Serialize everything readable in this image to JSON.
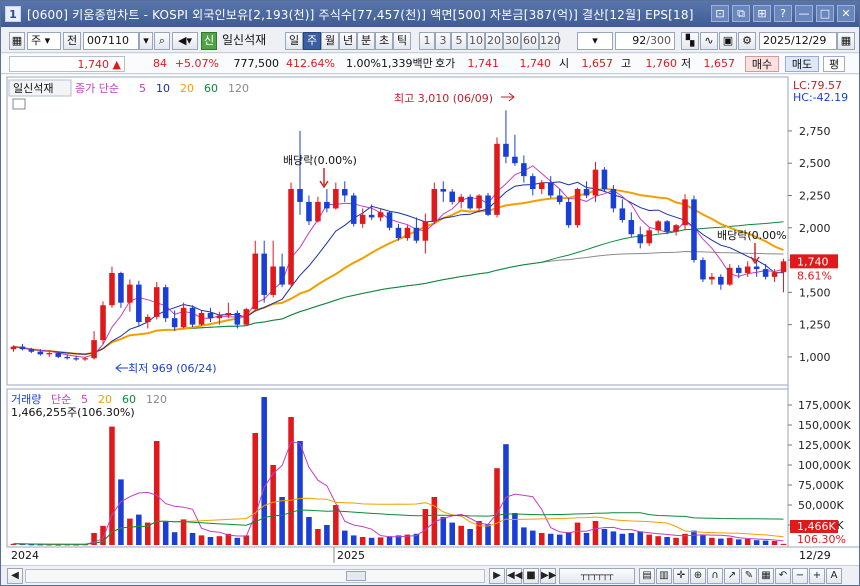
{
  "window": {
    "title": "[0600] 키움종합차트 - KOSPI 외국인보유[2,193(천)] 주식수[77,457(천)] 액면[500] 자본금[387(억)] 결산[12월] EPS[18]",
    "icon_label": "1",
    "controls": [
      "?",
      "_",
      "□",
      "?",
      "—",
      "✕"
    ]
  },
  "toolbar": {
    "market_select": "주",
    "market_icon": "전",
    "stock_code": "007110",
    "stock_name": "일신석재",
    "periods": [
      "일",
      "주",
      "월",
      "년",
      "분",
      "초",
      "틱"
    ],
    "active_period": "주",
    "intervals": [
      "1",
      "3",
      "5",
      "10",
      "20",
      "30",
      "60",
      "120"
    ],
    "count": "92",
    "count_total": "/300",
    "date": "2025/12/29",
    "badge": "신"
  },
  "quote": {
    "price": "1,740",
    "arrow": "▲",
    "change": "84",
    "change_pct": "+5.07%",
    "volume": "777,500",
    "volume_ratio": "412.64%",
    "turnover": "1.00%",
    "amount": "1,339백만",
    "hoga_label": "호가",
    "ask": "1,741",
    "bid": "1,740",
    "open_label": "시",
    "open": "1,657",
    "high_label": "고",
    "high": "1,760",
    "low_label": "저",
    "low": "1,657",
    "buy_label": "매수",
    "sell_label": "매도",
    "eval_label": "평"
  },
  "price_panel": {
    "stock_label": "일신석재",
    "ma_title": "종가 단순",
    "ma_periods": [
      "5",
      "10",
      "20",
      "60",
      "120"
    ],
    "lc": "LC:79.57",
    "hc": "HC:-42.19",
    "high_annotation": "최고 3,010 (06/09)",
    "low_annotation": "최저 969 (06/24)",
    "dividend_label_1": "배당락(0.00%)",
    "dividend_label_2": "배당락(0.00%",
    "current_price_tag": "1,740",
    "current_pct_tag": "8.61%"
  },
  "volume_panel": {
    "title": "거래량",
    "ma_title": "단순",
    "ma_periods": [
      "5",
      "20",
      "60",
      "120"
    ],
    "value_label": "1,466,255주(106.30%)",
    "current_tag": "1,466K",
    "pct_tag": "106.30%"
  },
  "x_labels": [
    "2024",
    "2025",
    "12/29"
  ],
  "colors": {
    "up": "#e0191b",
    "down": "#1a3fd6",
    "ma5": "#c040c0",
    "ma10": "#1a2fa8",
    "ma20": "#f0a000",
    "ma60": "#0a8a3a",
    "ma120": "#8a8a8a"
  },
  "chart_data": {
    "type": "candlestick",
    "price_axis": {
      "ticks": [
        1000,
        1250,
        1500,
        1750,
        2000,
        2250,
        2500,
        2750
      ],
      "ylim": [
        860,
        3090
      ]
    },
    "volume_axis": {
      "ticks": [
        "25,000K",
        "50,000K",
        "75,000K",
        "100,000K",
        "125,000K",
        "150,000K",
        "175,000K"
      ],
      "ylim": [
        0,
        190000
      ]
    },
    "candles": [
      [
        1060,
        1090,
        1040,
        1080,
        1500
      ],
      [
        1080,
        1100,
        1050,
        1060,
        1200
      ],
      [
        1060,
        1070,
        1030,
        1040,
        900
      ],
      [
        1040,
        1060,
        1010,
        1020,
        800
      ],
      [
        1020,
        1050,
        1000,
        1030,
        700
      ],
      [
        1030,
        1040,
        990,
        1000,
        600
      ],
      [
        1000,
        1020,
        980,
        990,
        800
      ],
      [
        990,
        1010,
        970,
        980,
        700
      ],
      [
        980,
        1000,
        969,
        990,
        900
      ],
      [
        990,
        1200,
        980,
        1130,
        15000
      ],
      [
        1130,
        1430,
        1100,
        1400,
        24000
      ],
      [
        1400,
        1700,
        1380,
        1650,
        148000
      ],
      [
        1650,
        1660,
        1380,
        1420,
        82000
      ],
      [
        1420,
        1600,
        1350,
        1560,
        33000
      ],
      [
        1560,
        1590,
        1240,
        1270,
        38000
      ],
      [
        1270,
        1330,
        1220,
        1310,
        28000
      ],
      [
        1310,
        1580,
        1290,
        1540,
        130000
      ],
      [
        1540,
        1560,
        1270,
        1300,
        30000
      ],
      [
        1300,
        1360,
        1200,
        1230,
        16000
      ],
      [
        1230,
        1420,
        1220,
        1380,
        32000
      ],
      [
        1380,
        1400,
        1230,
        1250,
        15000
      ],
      [
        1250,
        1360,
        1240,
        1340,
        12000
      ],
      [
        1340,
        1380,
        1270,
        1300,
        10000
      ],
      [
        1300,
        1350,
        1250,
        1320,
        11000
      ],
      [
        1320,
        1420,
        1300,
        1340,
        14000
      ],
      [
        1340,
        1360,
        1220,
        1250,
        9000
      ],
      [
        1250,
        1380,
        1240,
        1370,
        12000
      ],
      [
        1370,
        1900,
        1350,
        1800,
        140000
      ],
      [
        1800,
        1900,
        1420,
        1480,
        185000
      ],
      [
        1480,
        1900,
        1460,
        1700,
        100000
      ],
      [
        1700,
        1800,
        1540,
        1560,
        60000
      ],
      [
        1560,
        2350,
        1540,
        2300,
        160000
      ],
      [
        2300,
        2750,
        2100,
        2200,
        130000
      ],
      [
        2200,
        2250,
        2020,
        2050,
        35000
      ],
      [
        2050,
        2240,
        2040,
        2200,
        20000
      ],
      [
        2200,
        2300,
        2120,
        2150,
        25000
      ],
      [
        2150,
        2350,
        2140,
        2300,
        50000
      ],
      [
        2300,
        2360,
        2200,
        2250,
        18000
      ],
      [
        2250,
        2270,
        2010,
        2030,
        12000
      ],
      [
        2030,
        2150,
        2000,
        2100,
        10000
      ],
      [
        2100,
        2180,
        2060,
        2080,
        9000
      ],
      [
        2080,
        2150,
        2050,
        2120,
        9500
      ],
      [
        2120,
        2130,
        1980,
        2000,
        11000
      ],
      [
        2000,
        2030,
        1900,
        1920,
        12000
      ],
      [
        1920,
        2020,
        1900,
        2000,
        13000
      ],
      [
        2000,
        2080,
        1880,
        1900,
        14000
      ],
      [
        1900,
        2110,
        1800,
        2050,
        45000
      ],
      [
        2050,
        2350,
        2030,
        2300,
        60000
      ],
      [
        2300,
        2360,
        2200,
        2280,
        35000
      ],
      [
        2280,
        2300,
        2180,
        2200,
        28000
      ],
      [
        2200,
        2260,
        2150,
        2240,
        24000
      ],
      [
        2240,
        2260,
        2140,
        2150,
        20000
      ],
      [
        2150,
        2260,
        2120,
        2250,
        30000
      ],
      [
        2250,
        2270,
        2090,
        2100,
        26000
      ],
      [
        2100,
        2700,
        2080,
        2650,
        96000
      ],
      [
        2650,
        2910,
        2500,
        2550,
        126000
      ],
      [
        2550,
        2720,
        2480,
        2500,
        40000
      ],
      [
        2500,
        2560,
        2350,
        2400,
        22000
      ],
      [
        2400,
        2420,
        2250,
        2300,
        18000
      ],
      [
        2300,
        2370,
        2260,
        2350,
        15000
      ],
      [
        2350,
        2400,
        2230,
        2250,
        14000
      ],
      [
        2250,
        2300,
        2180,
        2200,
        13000
      ],
      [
        2200,
        2230,
        2000,
        2020,
        16000
      ],
      [
        2020,
        2310,
        2000,
        2300,
        28000
      ],
      [
        2300,
        2360,
        2230,
        2250,
        15000
      ],
      [
        2250,
        2510,
        2200,
        2450,
        30000
      ],
      [
        2450,
        2470,
        2280,
        2300,
        20000
      ],
      [
        2300,
        2330,
        2120,
        2150,
        17000
      ],
      [
        2150,
        2220,
        2040,
        2060,
        14000
      ],
      [
        2060,
        2120,
        1930,
        1950,
        15000
      ],
      [
        1950,
        2010,
        1840,
        1880,
        17000
      ],
      [
        1880,
        2000,
        1860,
        1980,
        13000
      ],
      [
        1980,
        2060,
        1960,
        2050,
        11000
      ],
      [
        2050,
        2060,
        1950,
        1970,
        10000
      ],
      [
        1970,
        2030,
        1940,
        2020,
        9000
      ],
      [
        2020,
        2260,
        1980,
        2220,
        14000
      ],
      [
        2220,
        2250,
        1730,
        1750,
        18000
      ],
      [
        1750,
        1770,
        1580,
        1600,
        12000
      ],
      [
        1600,
        1650,
        1560,
        1620,
        9000
      ],
      [
        1620,
        1640,
        1520,
        1560,
        8000
      ],
      [
        1560,
        1720,
        1550,
        1690,
        9000
      ],
      [
        1690,
        1710,
        1610,
        1650,
        7000
      ],
      [
        1650,
        1740,
        1620,
        1700,
        7500
      ],
      [
        1700,
        1750,
        1620,
        1680,
        6000
      ],
      [
        1680,
        1720,
        1600,
        1620,
        5500
      ],
      [
        1620,
        1680,
        1580,
        1656,
        5000
      ],
      [
        1656,
        1760,
        1500,
        1740,
        1466
      ]
    ]
  }
}
